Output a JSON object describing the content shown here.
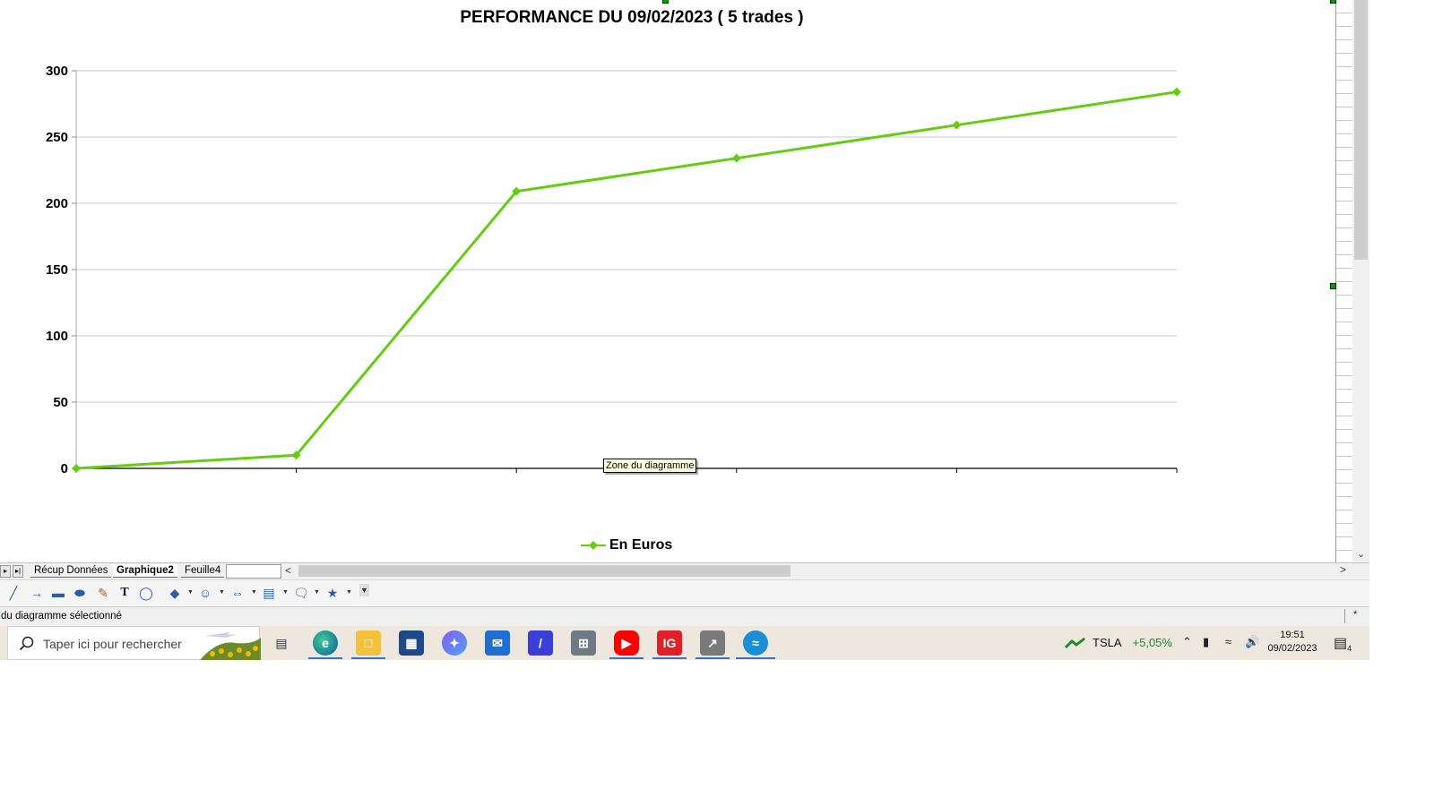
{
  "chart_data": {
    "type": "line",
    "title": "PERFORMANCE DU 09/02/2023 ( 5 trades )",
    "x": [
      0,
      1,
      2,
      3,
      4,
      5
    ],
    "series": [
      {
        "name": "En Euros",
        "values": [
          0,
          10,
          209,
          234,
          259,
          284
        ],
        "color": "#66cc11",
        "marker": "diamond"
      }
    ],
    "yticks": [
      0,
      50,
      100,
      150,
      200,
      250,
      300
    ],
    "ylim": [
      0,
      300
    ],
    "xlabel": "",
    "ylabel": "",
    "grid": true,
    "legend_position": "bottom"
  },
  "tooltip": "Zone du diagramme",
  "sheet_tabs": [
    {
      "label": "Récup Données",
      "active": false
    },
    {
      "label": "Graphique2",
      "active": true
    },
    {
      "label": "Feuille4",
      "active": false
    }
  ],
  "status": {
    "text": "du diagramme sélectionné",
    "modified": "*"
  },
  "taskbar": {
    "search_placeholder": "Taper ici pour rechercher",
    "ticker": {
      "symbol": "TSLA",
      "change": "+5,05%"
    },
    "time": "19:51",
    "date": "09/02/2023",
    "notifications": "4",
    "ig_label": "IG"
  },
  "colors": {
    "series": "#66cc11",
    "grid": "#c8c8c8",
    "axis": "#000000"
  },
  "icons": {
    "drawbar": [
      "line-icon",
      "arrow-icon",
      "rectangle-icon",
      "ellipse-icon",
      "freeform-icon",
      "text-icon",
      "callout-icon",
      "basic-shapes-icon",
      "symbol-shapes-icon",
      "block-arrows-icon",
      "flowchart-icon",
      "callouts-icon",
      "stars-icon"
    ],
    "taskbar": [
      "task-view-icon",
      "edge-icon",
      "file-explorer-icon",
      "store-icon",
      "teams-icon",
      "mail-icon",
      "app-icon",
      "calculator-icon",
      "youtube-icon",
      "ig-icon",
      "stock-app-icon",
      "browser-icon"
    ]
  }
}
